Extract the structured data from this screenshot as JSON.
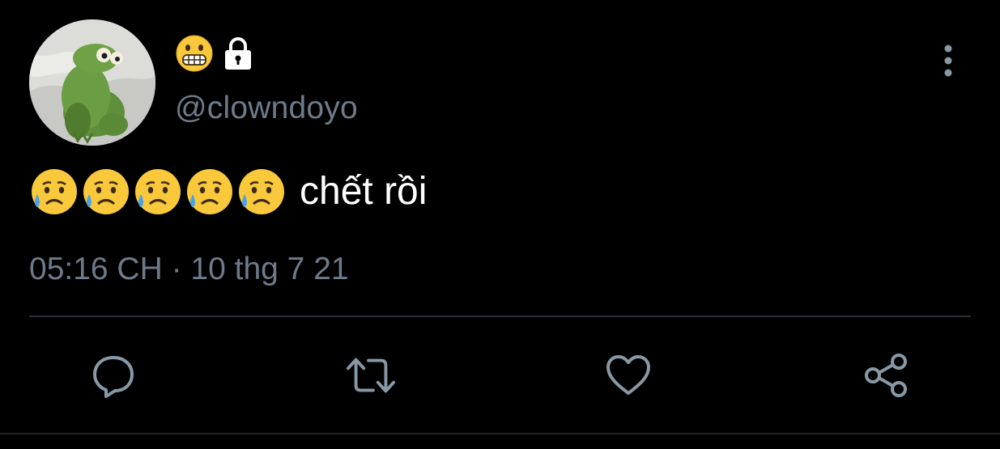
{
  "author": {
    "display_name_icons": [
      "grimacing-emoji",
      "lock-icon"
    ],
    "handle": "@clowndoyo",
    "avatar_icon": "avatar"
  },
  "tweet": {
    "emoji_icons": [
      "sad-tear-emoji",
      "sad-tear-emoji",
      "sad-tear-emoji",
      "sad-tear-emoji",
      "sad-tear-emoji"
    ],
    "text": "chết rồi",
    "timestamp": "05:16 CH · 10 thg 7 21"
  },
  "actions": {
    "icons": [
      "reply-icon",
      "retweet-icon",
      "like-icon",
      "share-icon"
    ]
  },
  "menu": {
    "icon": "more-vertical-icon"
  },
  "colors": {
    "background": "#000000",
    "text_primary": "#ffffff",
    "text_secondary": "#6e7b8b",
    "icon": "#8899a6",
    "divider": "#2a2f33"
  }
}
